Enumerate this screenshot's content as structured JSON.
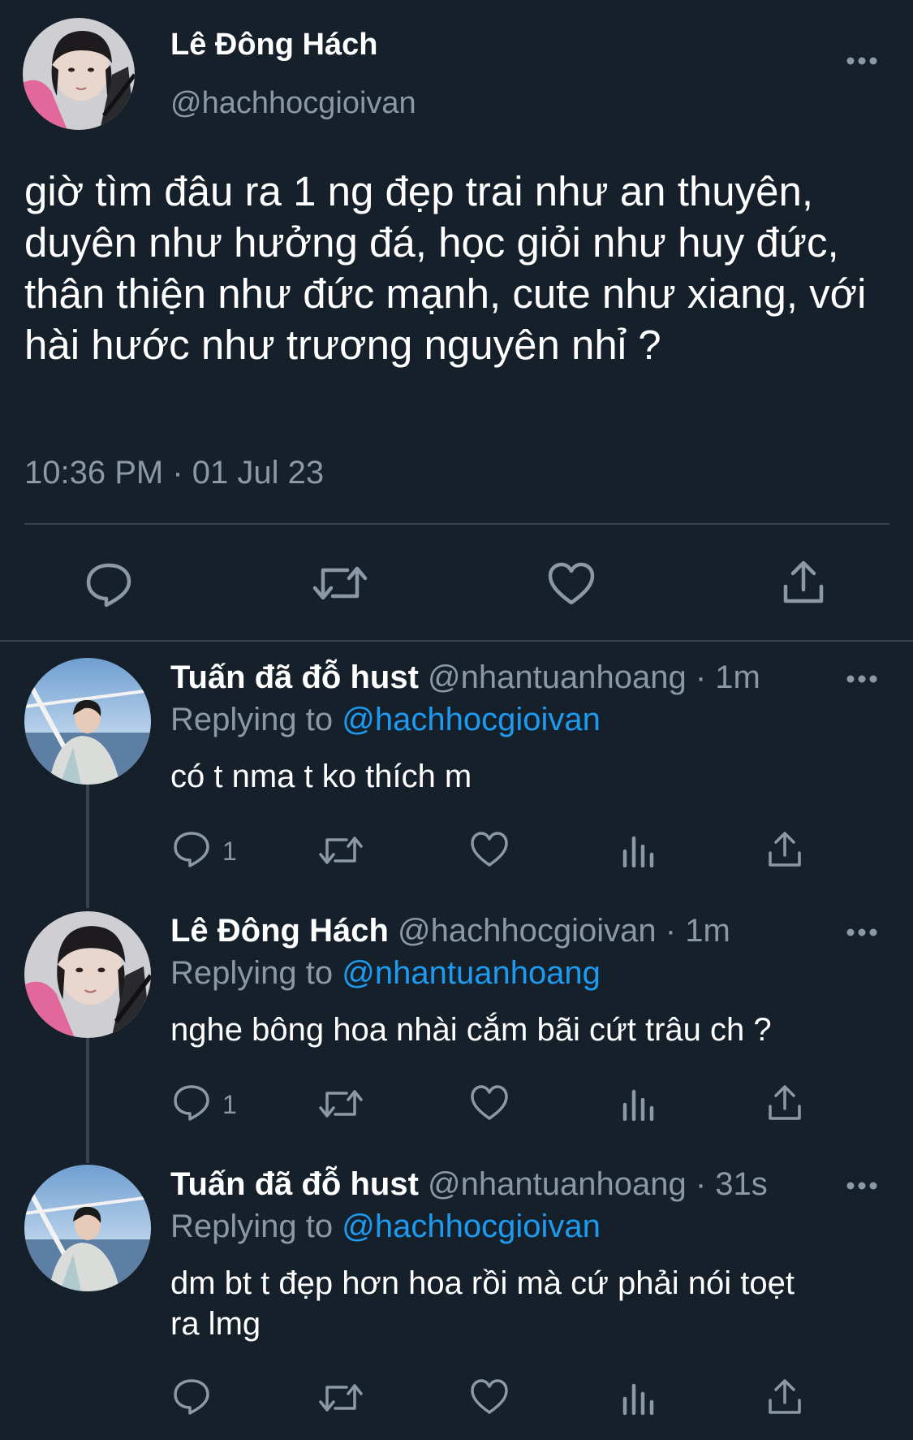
{
  "main_tweet": {
    "display_name": "Lê Đông Hách",
    "handle": "@hachhocgioivan",
    "text": "giờ tìm đâu ra 1 ng đẹp trai như an thuyên, duyên như hưởng đá, học giỏi như huy đức, thân thiện như đức mạnh, cute như xiang, với hài hước như trương nguyên nhỉ ?",
    "timestamp": "10:36 PM · 01 Jul 23",
    "actions": [
      "reply-icon",
      "retweet-icon",
      "like-icon",
      "share-icon"
    ]
  },
  "replies": [
    {
      "display_name": "Tuấn đã đỗ hust",
      "handle": "@nhantuanhoang",
      "sep": "·",
      "time": "1m",
      "replying_label": "Replying to",
      "replying_to": "@hachhocgioivan",
      "text": "có t nma t ko thích m",
      "reply_count": "1"
    },
    {
      "display_name": "Lê Đông Hách",
      "handle": "@hachhocgioivan",
      "sep": "·",
      "time": "1m",
      "replying_label": "Replying to",
      "replying_to": "@nhantuanhoang",
      "text": "nghe bông hoa nhài cắm bãi cứt trâu ch ?",
      "reply_count": "1"
    },
    {
      "display_name": "Tuấn đã đỗ hust",
      "handle": "@nhantuanhoang",
      "sep": "·",
      "time": "31s",
      "replying_label": "Replying to",
      "replying_to": "@hachhocgioivan",
      "text_line1": "dm bt t đẹp hơn hoa rồi mà cứ phải nói toẹt",
      "text_line2": "ra lmg",
      "reply_count": ""
    }
  ],
  "colors": {
    "background": "#15202b",
    "muted": "#8b98a5",
    "link": "#1d9bf0",
    "divider": "#38444d"
  }
}
